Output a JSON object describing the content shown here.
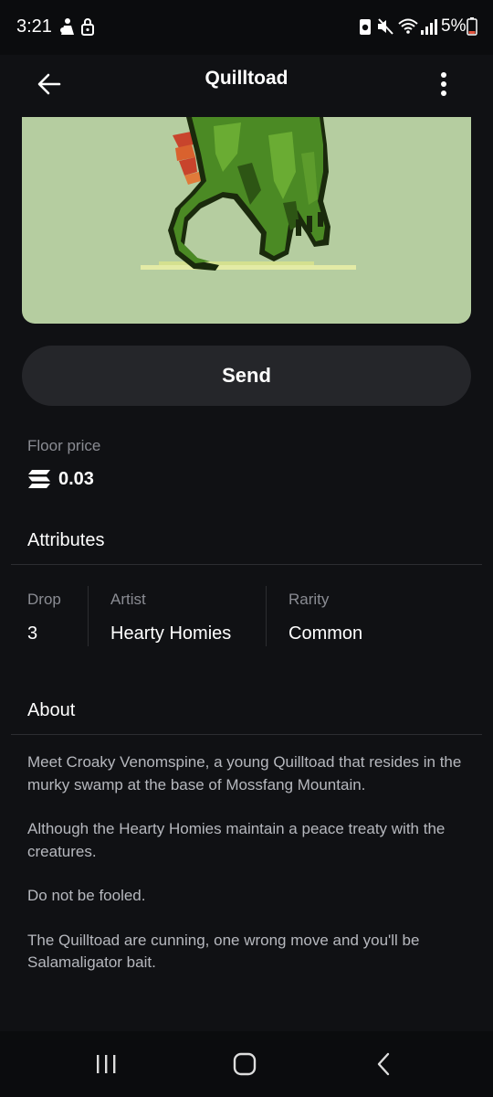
{
  "status_bar": {
    "time": "3:21",
    "battery": "5%",
    "icons": [
      "game-controller-icon",
      "lock-icon",
      "data-saver-icon",
      "mute-icon",
      "wifi-icon",
      "signal-icon",
      "battery-icon"
    ]
  },
  "header": {
    "title": "Quilltoad",
    "back_icon": "arrow-left-icon",
    "menu_icon": "more-vertical-icon"
  },
  "nft": {
    "image_description_icon": "pixel-art-creature-image",
    "background_color": "#b5cda0"
  },
  "send_button": {
    "label": "Send"
  },
  "floor_price": {
    "label": "Floor price",
    "currency_icon": "solana-icon",
    "value": "0.03"
  },
  "attributes": {
    "heading": "Attributes",
    "items": [
      {
        "label": "Drop",
        "value": "3"
      },
      {
        "label": "Artist",
        "value": "Hearty Homies"
      },
      {
        "label": "Rarity",
        "value": "Common"
      }
    ]
  },
  "about": {
    "heading": "About",
    "paragraphs": [
      "Meet Croaky Venomspine, a young Quilltoad that resides in the murky swamp at the base of Mossfang Mountain.",
      "Although the Hearty Homies maintain a peace treaty with the creatures.",
      "Do not be fooled.",
      "The Quilltoad are cunning, one wrong move and you'll be Salamaligator bait."
    ]
  },
  "nav_bar": {
    "recents_icon": "recents-icon",
    "home_icon": "home-icon",
    "back_icon": "back-chevron-icon"
  },
  "colors": {
    "background": "#101114",
    "button_bg": "#25262a",
    "muted_text": "#8a8c93",
    "body_text": "#b6b8be"
  }
}
